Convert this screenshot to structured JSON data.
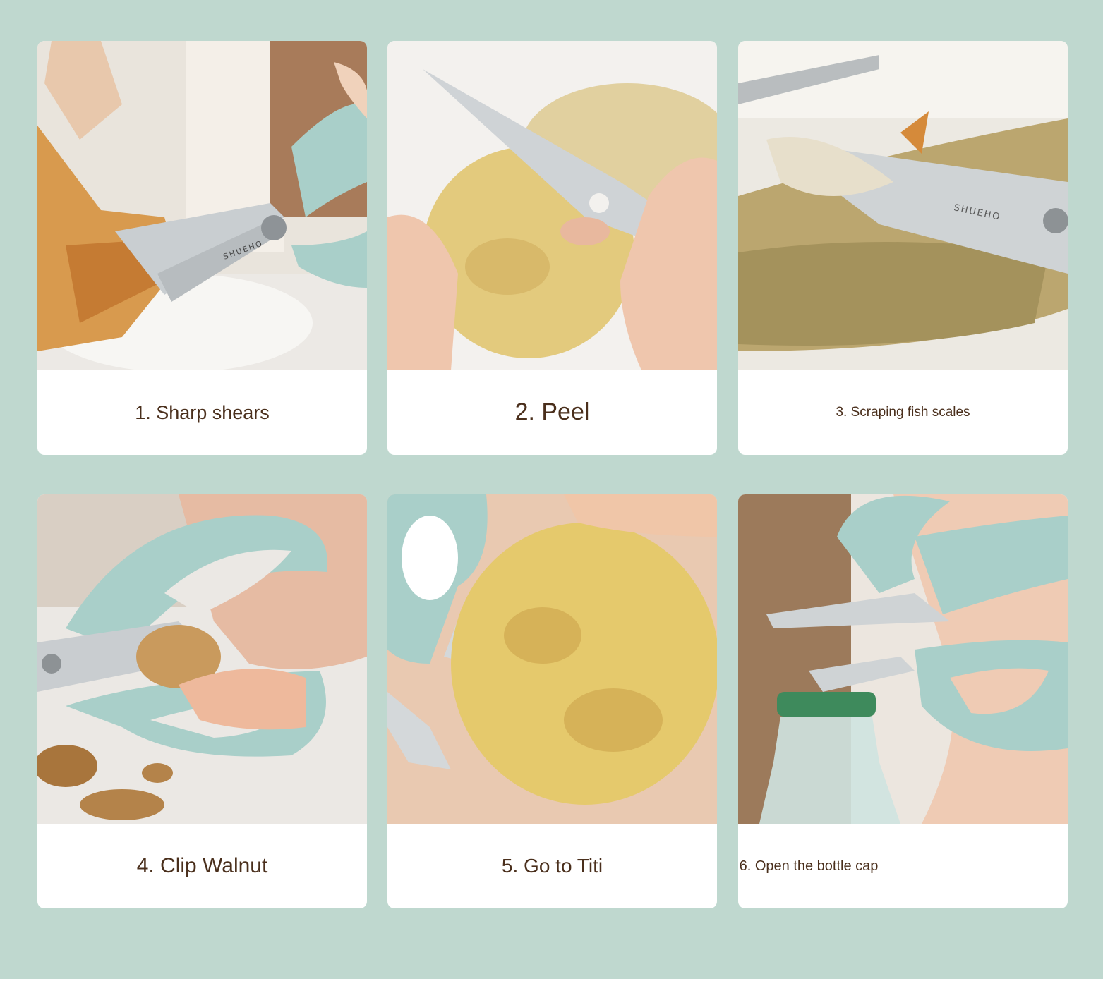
{
  "cards": [
    {
      "caption": "1. Sharp shears",
      "photo": "scissors-cutting-chicken-photo",
      "engraving": "SHUEHO"
    },
    {
      "caption": "2. Peel",
      "photo": "scissors-peeling-potato-photo"
    },
    {
      "caption": "3. Scraping fish scales",
      "photo": "scissors-scaling-fish-photo",
      "engraving": "SHUEHO"
    },
    {
      "caption": "4. Clip Walnut",
      "photo": "scissors-cracking-walnut-photo"
    },
    {
      "caption": "5. Go to Titi",
      "photo": "scissors-eye-removal-potato-photo"
    },
    {
      "caption": "6. Open the bottle cap",
      "photo": "scissors-opening-bottle-photo"
    }
  ],
  "colors": {
    "background": "#bfd8cf",
    "card": "#ffffff",
    "caption_text": "#4a2f1c",
    "handle": "#a9cfc9",
    "blade": "#c9ced1"
  }
}
